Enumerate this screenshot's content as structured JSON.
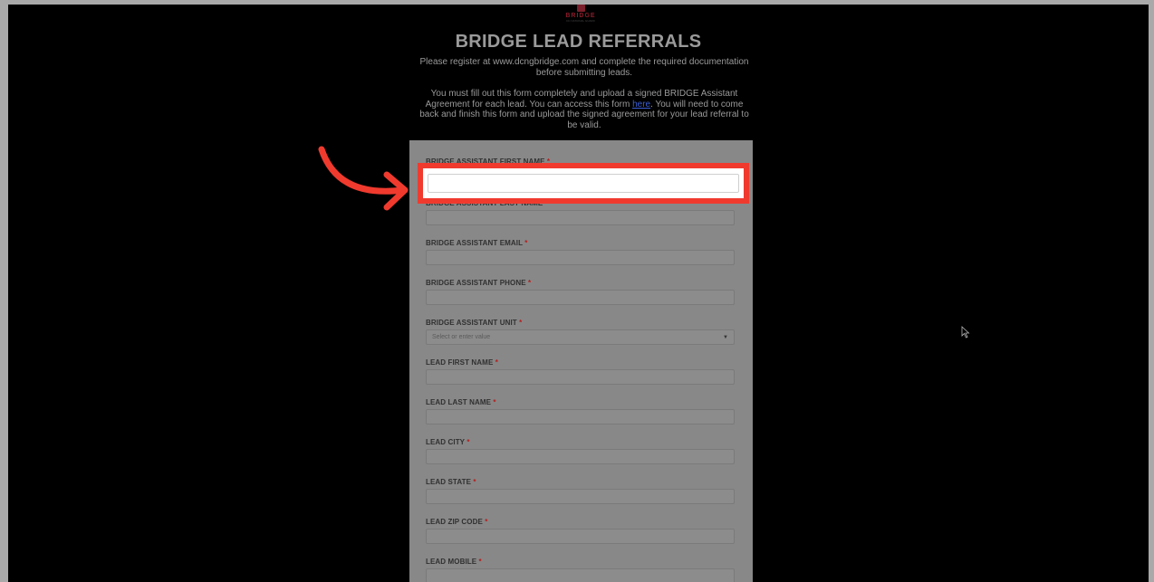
{
  "logo": {
    "word": "BRIDGE",
    "sub": "DC NATIONAL GUARD"
  },
  "header": {
    "title": "BRIDGE LEAD REFERRALS",
    "intro1": "Please register at www.dcngbridge.com and complete the required documentation before submitting leads.",
    "intro2_before": "You must fill out this form completely and upload a signed BRIDGE Assistant Agreement for each lead. You can access this form ",
    "intro2_link": "here",
    "intro2_after": ". You will need to come back and finish this form and upload the signed agreement for your lead referral to be valid."
  },
  "form": {
    "first_name_label": "BRIDGE ASSISTANT FIRST NAME",
    "last_name_label": "BRIDGE ASSISTANT LAST NAME",
    "email_label": "BRIDGE ASSISTANT EMAIL",
    "phone_label": "BRIDGE ASSISTANT PHONE",
    "unit_label": "BRIDGE ASSISTANT UNIT",
    "unit_placeholder": "Select or enter value",
    "lead_first_label": "LEAD FIRST NAME",
    "lead_last_label": "LEAD LAST NAME",
    "lead_city_label": "LEAD CITY",
    "lead_state_label": "LEAD STATE",
    "lead_zip_label": "LEAD ZIP CODE",
    "lead_mobile_label": "LEAD MOBILE",
    "required_marker": "*"
  },
  "colors": {
    "annotation": "#f03a2e",
    "required": "#b3201f"
  },
  "icons": {
    "arrow": "curved-arrow-icon",
    "cursor": "mouse-pointer-icon",
    "dropdown": "caret-down-icon"
  }
}
